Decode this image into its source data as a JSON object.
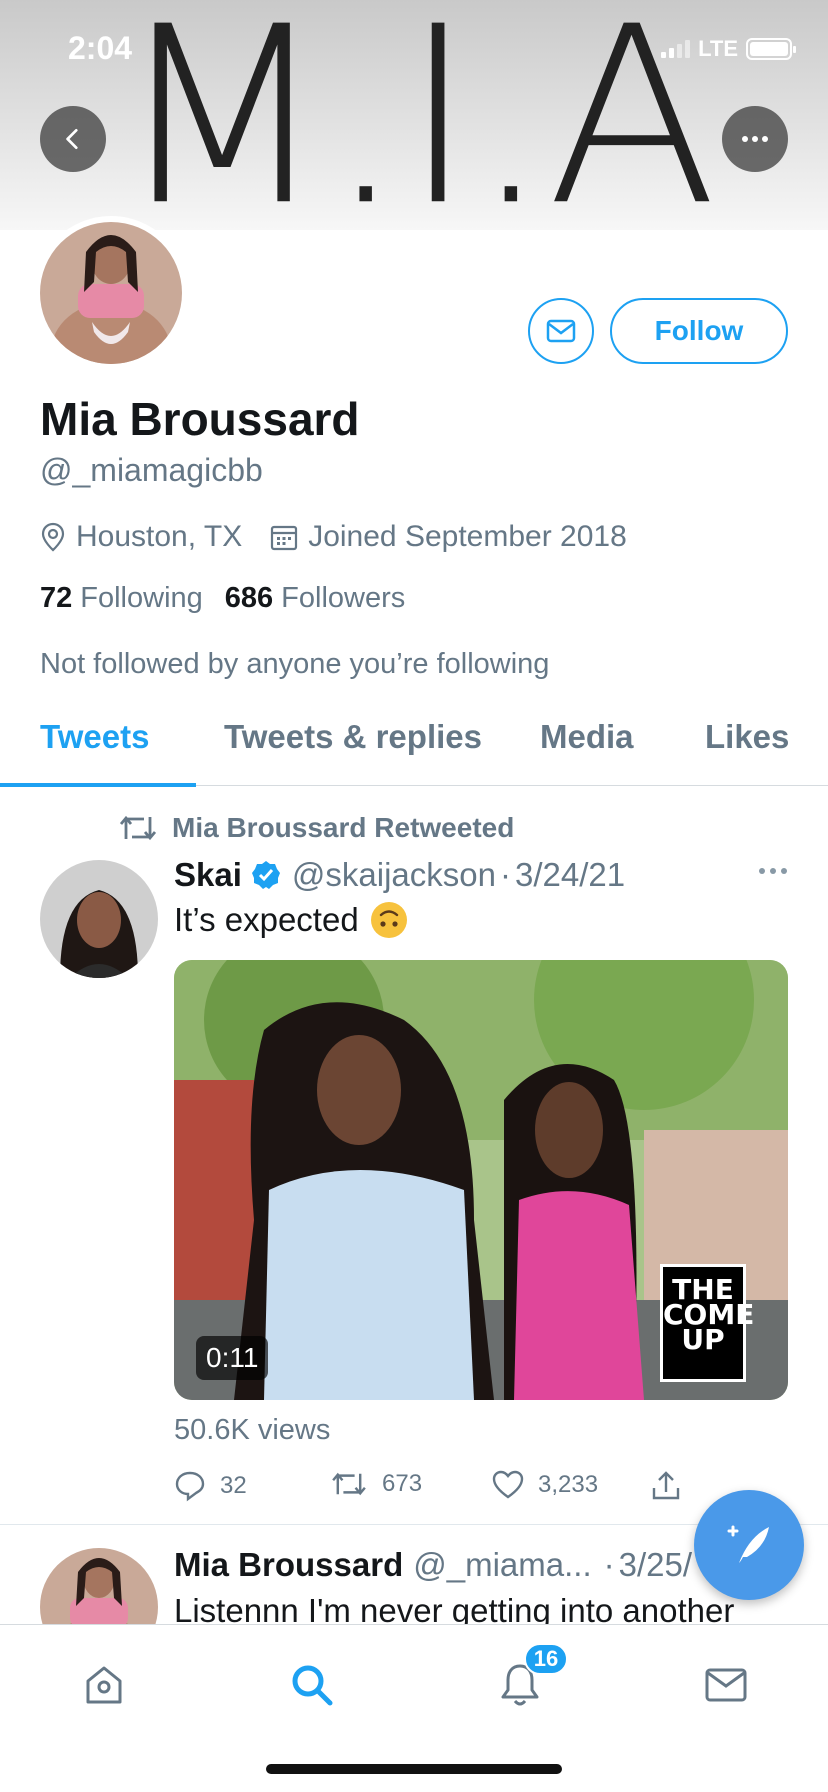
{
  "status_bar": {
    "time": "2:04",
    "network": "LTE"
  },
  "banner": {
    "text": "M.I.A"
  },
  "profile": {
    "name": "Mia Broussard",
    "handle": "@_miamagicbb",
    "location": "Houston, TX",
    "joined": "Joined September 2018",
    "following_count": "72",
    "following_label": "Following",
    "followers_count": "686",
    "followers_label": "Followers",
    "not_followed_text": "Not followed by anyone you’re following",
    "follow_label": "Follow"
  },
  "tabs": [
    {
      "label": "Tweets",
      "active": true
    },
    {
      "label": "Tweets & replies",
      "active": false
    },
    {
      "label": "Media",
      "active": false
    },
    {
      "label": "Likes",
      "active": false
    }
  ],
  "tweets": [
    {
      "retweet_context": "Mia Broussard Retweeted",
      "author_name": "Skai",
      "author_handle": "@skaijackson",
      "separator": "·",
      "date": "3/24/21",
      "text": "It’s expected",
      "media": {
        "duration": "0:11",
        "watermark": "THE COME UP"
      },
      "views": "50.6K views",
      "actions": {
        "replies": "32",
        "retweets": "673",
        "likes": "3,233"
      }
    },
    {
      "author_name": "Mia Broussard",
      "author_handle": "@_miama...",
      "separator": "·",
      "date": "3/25/",
      "text": "Listennn I'm never getting into another"
    }
  ],
  "bottom_nav": {
    "notifications_badge": "16"
  },
  "colors": {
    "accent": "#1da1f2",
    "secondary_text": "#657786",
    "fab": "#4a99e9"
  }
}
